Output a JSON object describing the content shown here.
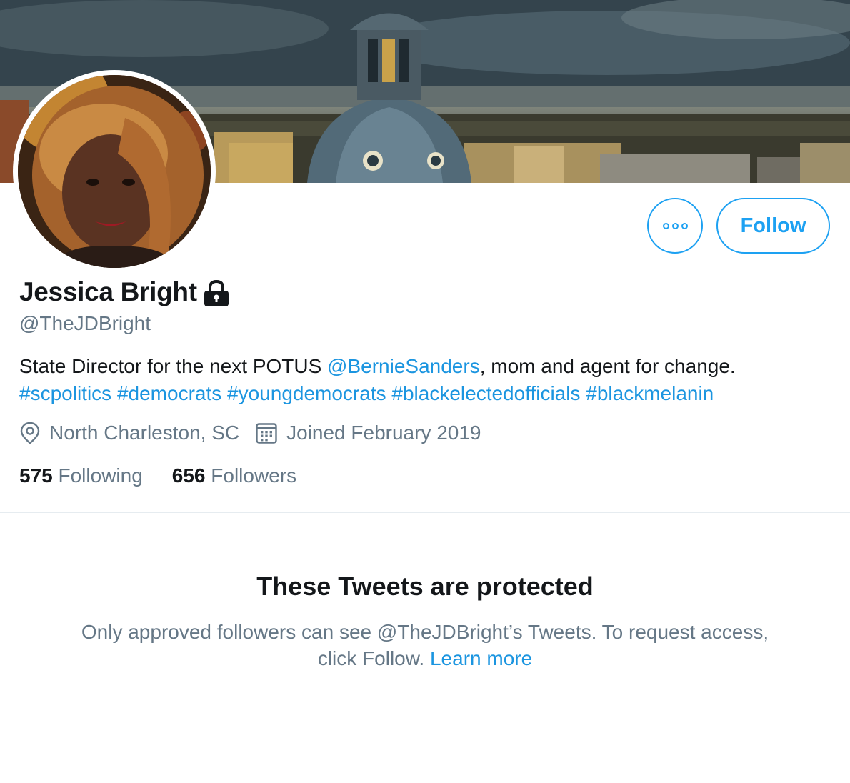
{
  "profile": {
    "display_name": "Jessica Bright",
    "handle": "@TheJDBright",
    "bio": {
      "text_1": "State Director for the next POTUS ",
      "mention": "@BernieSanders",
      "text_2": ", mom and agent for change.",
      "hashtags": [
        "#scpolitics",
        "#democrats",
        "#youngdemocrats",
        "#blackelectedofficials",
        "#blackmelanin"
      ]
    },
    "location": "North Charleston, SC",
    "joined": "Joined February 2019",
    "following_count": "575",
    "following_label": "Following",
    "followers_count": "656",
    "followers_label": "Followers"
  },
  "actions": {
    "follow_label": "Follow",
    "more_icon": "more-horizontal-icon"
  },
  "icons": {
    "lock": "lock-icon",
    "location": "location-pin-icon",
    "calendar": "calendar-icon"
  },
  "protected": {
    "title": "These Tweets are protected",
    "line_1": "Only approved followers can see @TheJDBright’s Tweets. To request access,",
    "line_2_text": "click Follow. ",
    "learn_more": "Learn more"
  },
  "colors": {
    "accent": "#1da1f2",
    "link": "#1b95e0",
    "text_primary": "#14171a",
    "text_secondary": "#657786",
    "divider": "#e6ecf0"
  }
}
